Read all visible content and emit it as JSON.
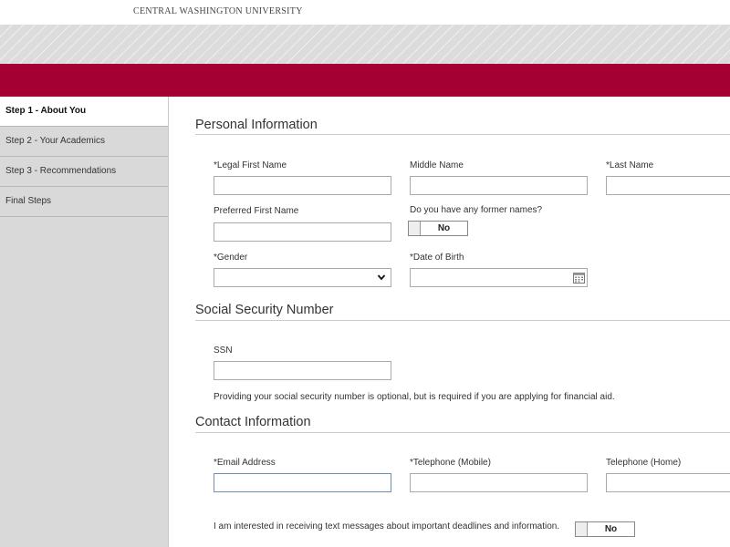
{
  "header": {
    "university": "CENTRAL WASHINGTON UNIVERSITY",
    "brand_color": "#a50034"
  },
  "sidebar": {
    "items": [
      {
        "label": "Step 1 - About You",
        "active": true
      },
      {
        "label": "Step 2 - Your Academics",
        "active": false
      },
      {
        "label": "Step 3 - Recommendations",
        "active": false
      },
      {
        "label": "Final Steps",
        "active": false
      }
    ]
  },
  "personal": {
    "title": "Personal Information",
    "first_name_label": "*Legal First Name",
    "middle_name_label": "Middle Name",
    "last_name_label": "*Last Name",
    "preferred_name_label": "Preferred First Name",
    "former_names_label": "Do you have any former names?",
    "former_names_value": "No",
    "gender_label": "*Gender",
    "gender_value": "",
    "dob_label": "*Date of Birth"
  },
  "ssn": {
    "title": "Social Security Number",
    "label": "SSN",
    "note": "Providing your social security number is optional, but is required if you are applying for financial aid."
  },
  "contact": {
    "title": "Contact Information",
    "email_label": "*Email Address",
    "mobile_label": "*Telephone (Mobile)",
    "home_label": "Telephone (Home)",
    "text_opt_label": "I am interested in receiving text messages about important deadlines and information.",
    "text_opt_value": "No"
  }
}
